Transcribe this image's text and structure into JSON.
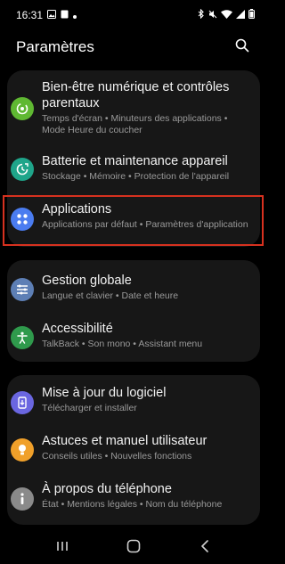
{
  "status": {
    "time": "16:31"
  },
  "header": {
    "title": "Paramètres"
  },
  "items": [
    {
      "title": "Bien-être numérique et contrôles parentaux",
      "subtitle": "Temps d'écran  •  Minuteurs des applications  •  Mode Heure du coucher",
      "icon": "digital-wellbeing-icon",
      "color": "#5fb832"
    },
    {
      "title": "Batterie et maintenance appareil",
      "subtitle": "Stockage  •  Mémoire  •  Protection de l'appareil",
      "icon": "device-care-icon",
      "color": "#1fa58a"
    },
    {
      "title": "Applications",
      "subtitle": "Applications par défaut  •  Paramètres d'application",
      "icon": "apps-icon",
      "color": "#4a7cf0"
    },
    {
      "title": "Gestion globale",
      "subtitle": "Langue et clavier  •  Date et heure",
      "icon": "general-management-icon",
      "color": "#5d7fb5"
    },
    {
      "title": "Accessibilité",
      "subtitle": "TalkBack  •  Son mono  •  Assistant menu",
      "icon": "accessibility-icon",
      "color": "#2f9a4c"
    },
    {
      "title": "Mise à jour du logiciel",
      "subtitle": "Télécharger et installer",
      "icon": "software-update-icon",
      "color": "#6a66e0"
    },
    {
      "title": "Astuces et manuel utilisateur",
      "subtitle": "Conseils utiles  •  Nouvelles fonctions",
      "icon": "tips-icon",
      "color": "#f0a02a"
    },
    {
      "title": "À propos du téléphone",
      "subtitle": "État  •  Mentions légales  •  Nom du téléphone",
      "icon": "about-phone-icon",
      "color": "#8a8a8a"
    }
  ],
  "colors": {
    "background": "#000000",
    "card": "#171717",
    "highlight_border": "#d7311f",
    "subtitle_text": "#9a9a9a"
  }
}
